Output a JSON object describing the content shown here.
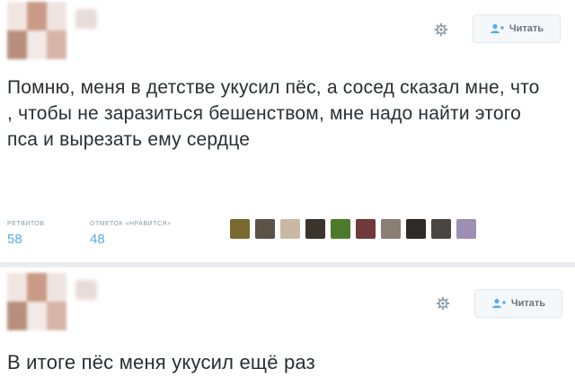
{
  "tweet1": {
    "follow_label": "Читать",
    "text": "Помню, меня в детстве укусил пёс, а сосед сказал мне, что , чтобы не заразиться бешенством, мне надо найти этого пса и вырезать ему сердце",
    "stats": {
      "retweets_label": "РЕТВИТОВ",
      "retweets_value": "58",
      "likes_label": "ОТМЕТОК «НРАВИТСЯ»",
      "likes_value": "48"
    },
    "liker_avatars": [
      {
        "color": "#7a6a2e"
      },
      {
        "color": "#5c5348"
      },
      {
        "color": "#c9b9a2"
      },
      {
        "color": "#3b332c"
      },
      {
        "color": "#4d7a2c"
      },
      {
        "color": "#6e3a3a"
      },
      {
        "color": "#8a7f74"
      },
      {
        "color": "#2e2a28"
      },
      {
        "color": "#4b4542"
      },
      {
        "color": "#9c8fb3"
      }
    ]
  },
  "tweet2": {
    "follow_label": "Читать",
    "text": "В итоге пёс меня укусил ещё раз"
  },
  "colors": {
    "link_blue": "#55acee",
    "muted": "#8899a6",
    "text": "#292f33"
  },
  "icons": {
    "settings": "gear-icon",
    "follow": "add-user-icon"
  }
}
